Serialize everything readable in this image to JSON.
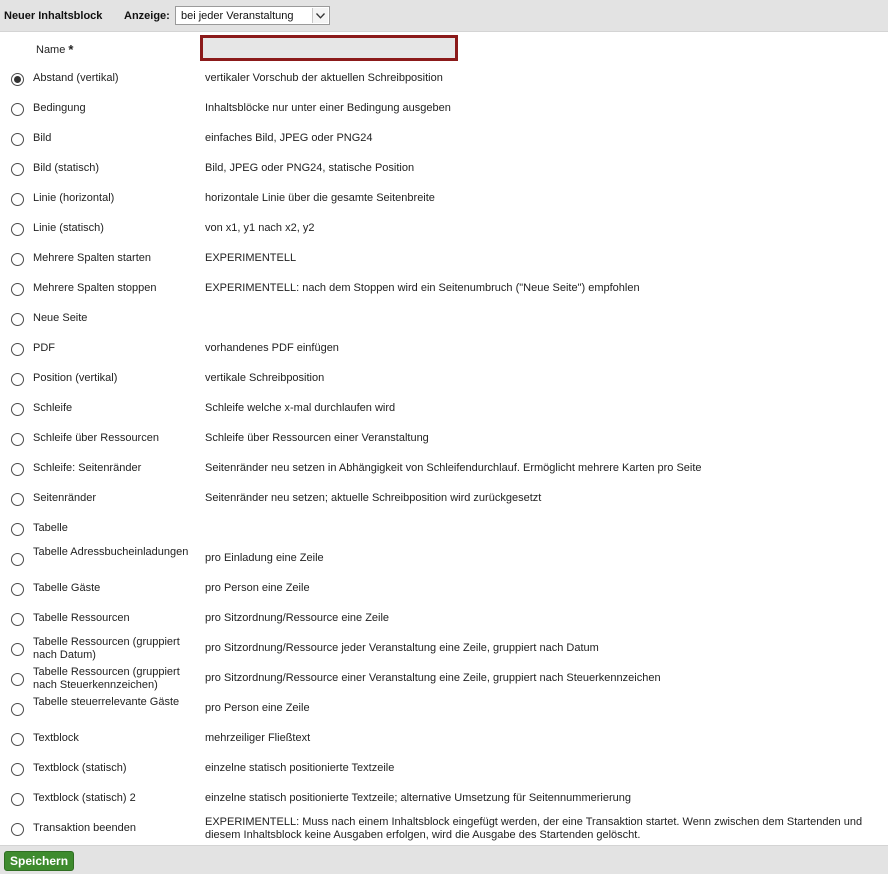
{
  "header": {
    "title": "Neuer Inhaltsblock",
    "anzeige_label": "Anzeige:",
    "anzeige_value": "bei jeder Veranstaltung"
  },
  "name_field": {
    "label": "Name",
    "required_mark": "*",
    "value": ""
  },
  "options": [
    {
      "label": "Abstand (vertikal)",
      "desc": "vertikaler Vorschub der aktuellen Schreibposition",
      "checked": true
    },
    {
      "label": "Bedingung",
      "desc": "Inhaltsblöcke nur unter einer Bedingung ausgeben"
    },
    {
      "label": "Bild",
      "desc": "einfaches Bild, JPEG oder PNG24"
    },
    {
      "label": "Bild (statisch)",
      "desc": "Bild, JPEG oder PNG24, statische Position"
    },
    {
      "label": "Linie (horizontal)",
      "desc": "horizontale Linie über die gesamte Seitenbreite"
    },
    {
      "label": "Linie (statisch)",
      "desc": "von x1, y1 nach x2, y2"
    },
    {
      "label": "Mehrere Spalten starten",
      "desc": "EXPERIMENTELL"
    },
    {
      "label": "Mehrere Spalten stoppen",
      "desc": "EXPERIMENTELL: nach dem Stoppen wird ein Seitenumbruch (\"Neue Seite\") empfohlen"
    },
    {
      "label": "Neue Seite",
      "desc": ""
    },
    {
      "label": "PDF",
      "desc": "vorhandenes PDF einfügen"
    },
    {
      "label": "Position (vertikal)",
      "desc": "vertikale Schreibposition"
    },
    {
      "label": "Schleife",
      "desc": "Schleife welche x-mal durchlaufen wird"
    },
    {
      "label": "Schleife über Ressourcen",
      "desc": "Schleife über Ressourcen einer Veranstaltung"
    },
    {
      "label": "Schleife: Seitenränder",
      "desc": "Seitenränder neu setzen in Abhängigkeit von Schleifendurchlauf. Ermöglicht mehrere Karten pro Seite"
    },
    {
      "label": "Seitenränder",
      "desc": "Seitenränder neu setzen; aktuelle Schreibposition wird zurückgesetzt"
    },
    {
      "label": "Tabelle",
      "desc": ""
    },
    {
      "label": "Tabelle Adressbucheinladungen",
      "desc": "pro Einladung eine Zeile"
    },
    {
      "label": "Tabelle Gäste",
      "desc": "pro Person eine Zeile"
    },
    {
      "label": "Tabelle Ressourcen",
      "desc": "pro Sitzordnung/Ressource eine Zeile"
    },
    {
      "label": "Tabelle Ressourcen (gruppiert nach Datum)",
      "desc": "pro Sitzordnung/Ressource jeder Veranstaltung eine Zeile, gruppiert nach Datum"
    },
    {
      "label": "Tabelle Ressourcen (gruppiert nach Steuerkennzeichen)",
      "desc": "pro Sitzordnung/Ressource einer Veranstaltung eine Zeile, gruppiert nach Steuerkennzeichen"
    },
    {
      "label": "Tabelle steuerrelevante Gäste",
      "desc": "pro Person eine Zeile"
    },
    {
      "label": "Textblock",
      "desc": "mehrzeiliger Fließtext"
    },
    {
      "label": "Textblock (statisch)",
      "desc": "einzelne statisch positionierte Textzeile"
    },
    {
      "label": "Textblock (statisch) 2",
      "desc": "einzelne statisch positionierte Textzeile; alternative Umsetzung für Seitennummerierung"
    },
    {
      "label": "Transaktion beenden",
      "desc": "EXPERIMENTELL: Muss nach einem Inhaltsblock eingefügt werden, der eine Transaktion startet. Wenn zwischen dem Startenden und diesem Inhaltsblock keine Ausgaben erfolgen, wird die Ausgabe des Startenden gelöscht."
    }
  ],
  "footer": {
    "save_label": "Speichern"
  }
}
